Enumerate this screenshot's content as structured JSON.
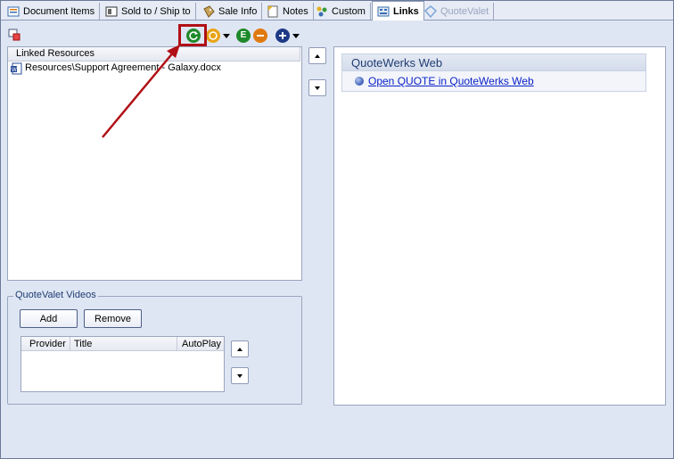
{
  "tabs": [
    {
      "label": "Document Items",
      "icon": "document-items-icon"
    },
    {
      "label": "Sold to / Ship to",
      "icon": "sold-to-icon"
    },
    {
      "label": "Sale Info",
      "icon": "sale-info-icon"
    },
    {
      "label": "Notes",
      "icon": "notes-icon"
    },
    {
      "label": "Custom",
      "icon": "custom-icon"
    },
    {
      "label": "Links",
      "icon": "links-icon"
    },
    {
      "label": "QuoteValet",
      "icon": "quotevalet-icon"
    }
  ],
  "toolbar": {
    "icons": [
      "link-tool-icon",
      "refresh-icon",
      "coin-icon",
      "e-icon",
      "remove-icon",
      "add-icon"
    ],
    "colors": {
      "refresh": "#1f8a2a",
      "coin": "#e8a417",
      "e": "#1f8a2a",
      "remove": "#e07a10",
      "add": "#1c3a86"
    }
  },
  "linked_resources": {
    "header": "Linked Resources",
    "items": [
      {
        "label": "Resources\\Support Agreement - Galaxy.docx",
        "icon": "word-doc-icon"
      }
    ]
  },
  "quotewerks_web": {
    "title": "QuoteWerks Web",
    "link": "Open QUOTE in QuoteWerks Web"
  },
  "quotevalet_videos": {
    "label": "QuoteValet Videos",
    "add_label": "Add",
    "remove_label": "Remove",
    "columns": [
      "Provider",
      "Title",
      "AutoPlay"
    ]
  },
  "annotation": {
    "color": "#b01016"
  }
}
